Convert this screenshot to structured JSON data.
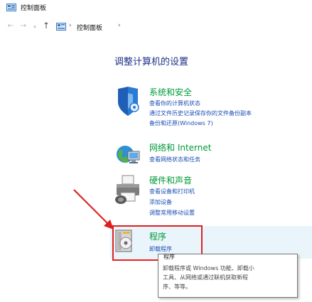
{
  "window": {
    "title": "控制面板"
  },
  "address_bar": {
    "back_icon": "back-arrow",
    "forward_icon": "forward-arrow",
    "up_icon": "up-arrow",
    "crumb": "控制面板",
    "separator": "›"
  },
  "main": {
    "heading": "调整计算机的设置",
    "categories": [
      {
        "title": "系统和安全",
        "icon": "shield-icon",
        "links": [
          "查看你的计算机状态",
          "通过文件历史记录保存你的文件备份副本",
          "备份和还原(Windows 7)"
        ]
      },
      {
        "title": "网络和 Internet",
        "icon": "network-globe-icon",
        "links": [
          "查看网络状态和任务"
        ]
      },
      {
        "title": "硬件和声音",
        "icon": "printer-icon",
        "links": [
          "查看设备和打印机",
          "添加设备",
          "调整常用移动设置"
        ]
      },
      {
        "title": "程序",
        "icon": "programs-disc-icon",
        "links": [
          "卸载程序"
        ]
      }
    ]
  },
  "tooltip": {
    "header": "程序",
    "lines": [
      "卸载程序或 Windows 功能、卸载小",
      "工具、从网络或通过联机获取新程",
      "序、等等。"
    ]
  },
  "annotation": {
    "highlight_color": "#e02020",
    "arrow_color": "#e02020"
  },
  "colors": {
    "category_title": "#009a3a",
    "link": "#1a4db4",
    "heading": "#1e3287"
  }
}
